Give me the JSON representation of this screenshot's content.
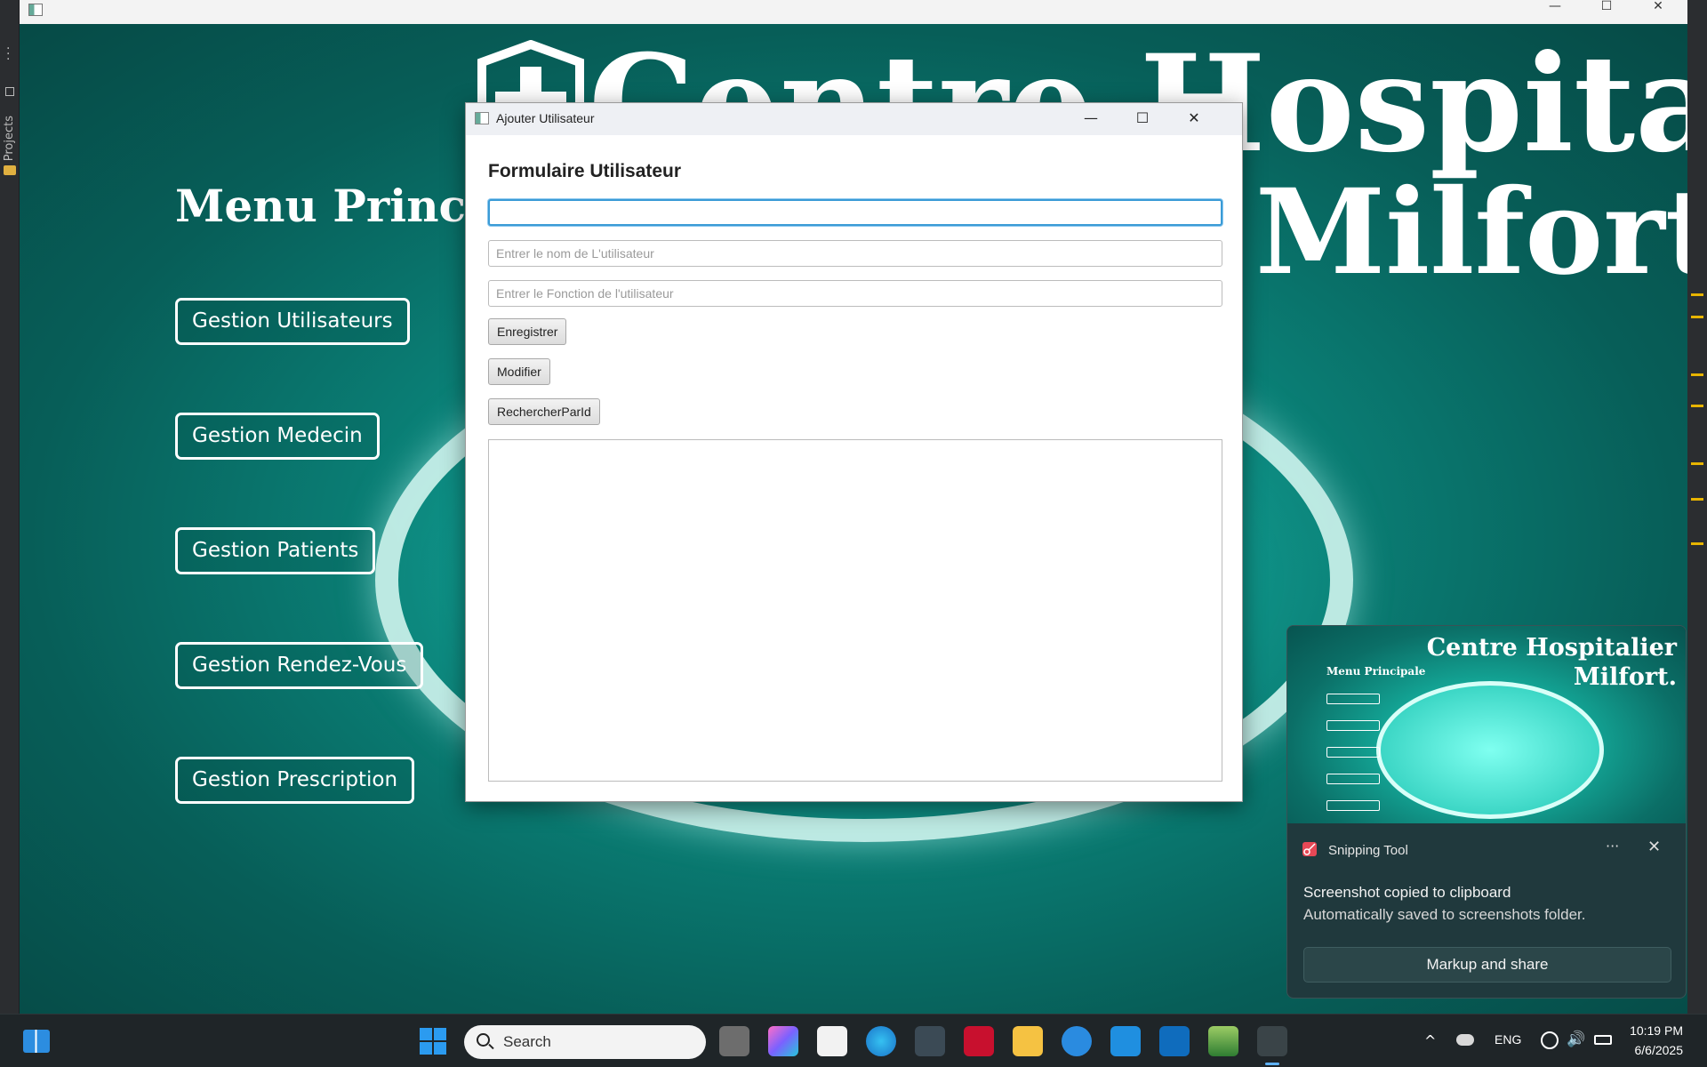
{
  "main_window": {
    "hospital_title_line1": "Centre Hospitalier",
    "hospital_title_line2": "Milfort.",
    "menu_title": "Menu Principale",
    "menu_buttons": [
      "Gestion Utilisateurs",
      "Gestion Medecin",
      "Gestion Patients",
      "Gestion Rendez-Vous",
      "Gestion Prescription"
    ],
    "controls": {
      "minimize": "—",
      "maximize": "☐",
      "close": "✕"
    }
  },
  "ide": {
    "projects_label": "Projects"
  },
  "dialog": {
    "title": "Ajouter Utilisateur",
    "controls": {
      "minimize": "—",
      "maximize": "☐",
      "close": "✕"
    },
    "heading": "Formulaire Utilisateur",
    "fields": {
      "id": {
        "value": "",
        "placeholder": ""
      },
      "name": {
        "value": "",
        "placeholder": "Entrer le nom de L'utilisateur"
      },
      "function": {
        "value": "",
        "placeholder": "Entrer le Fonction de l'utilisateur"
      }
    },
    "buttons": {
      "save": "Enregistrer",
      "modify": "Modifier",
      "search": "RechercherParId"
    },
    "result_text": ""
  },
  "toast": {
    "app_name": "Snipping Tool",
    "more": "···",
    "close": "✕",
    "message_title": "Screenshot copied to clipboard",
    "message_body": "Automatically saved to screenshots folder.",
    "action": "Markup and share",
    "preview": {
      "title_line1": "Centre Hospitalier",
      "title_line2": "Milfort.",
      "menu": "Menu Principale"
    }
  },
  "taskbar": {
    "search_label": "Search",
    "apps": [
      "file-explorer-icon",
      "copilot-icon",
      "store-icon",
      "edge-icon",
      "netbeans-icon",
      "mcafee-icon",
      "folder-icon",
      "help-icon",
      "myhp-icon",
      "outlook-icon",
      "app-icon",
      "java-app-icon"
    ],
    "tray": {
      "chevron": "^",
      "language": "ENG",
      "volume": "🔊",
      "time": "10:19 PM",
      "date": "6/6/2025"
    }
  },
  "colors": {
    "accent": "#3a9bd6",
    "brand_teal": "#0a7d74",
    "ide_dark": "#2b2d30",
    "taskbar": "#1f2528"
  }
}
